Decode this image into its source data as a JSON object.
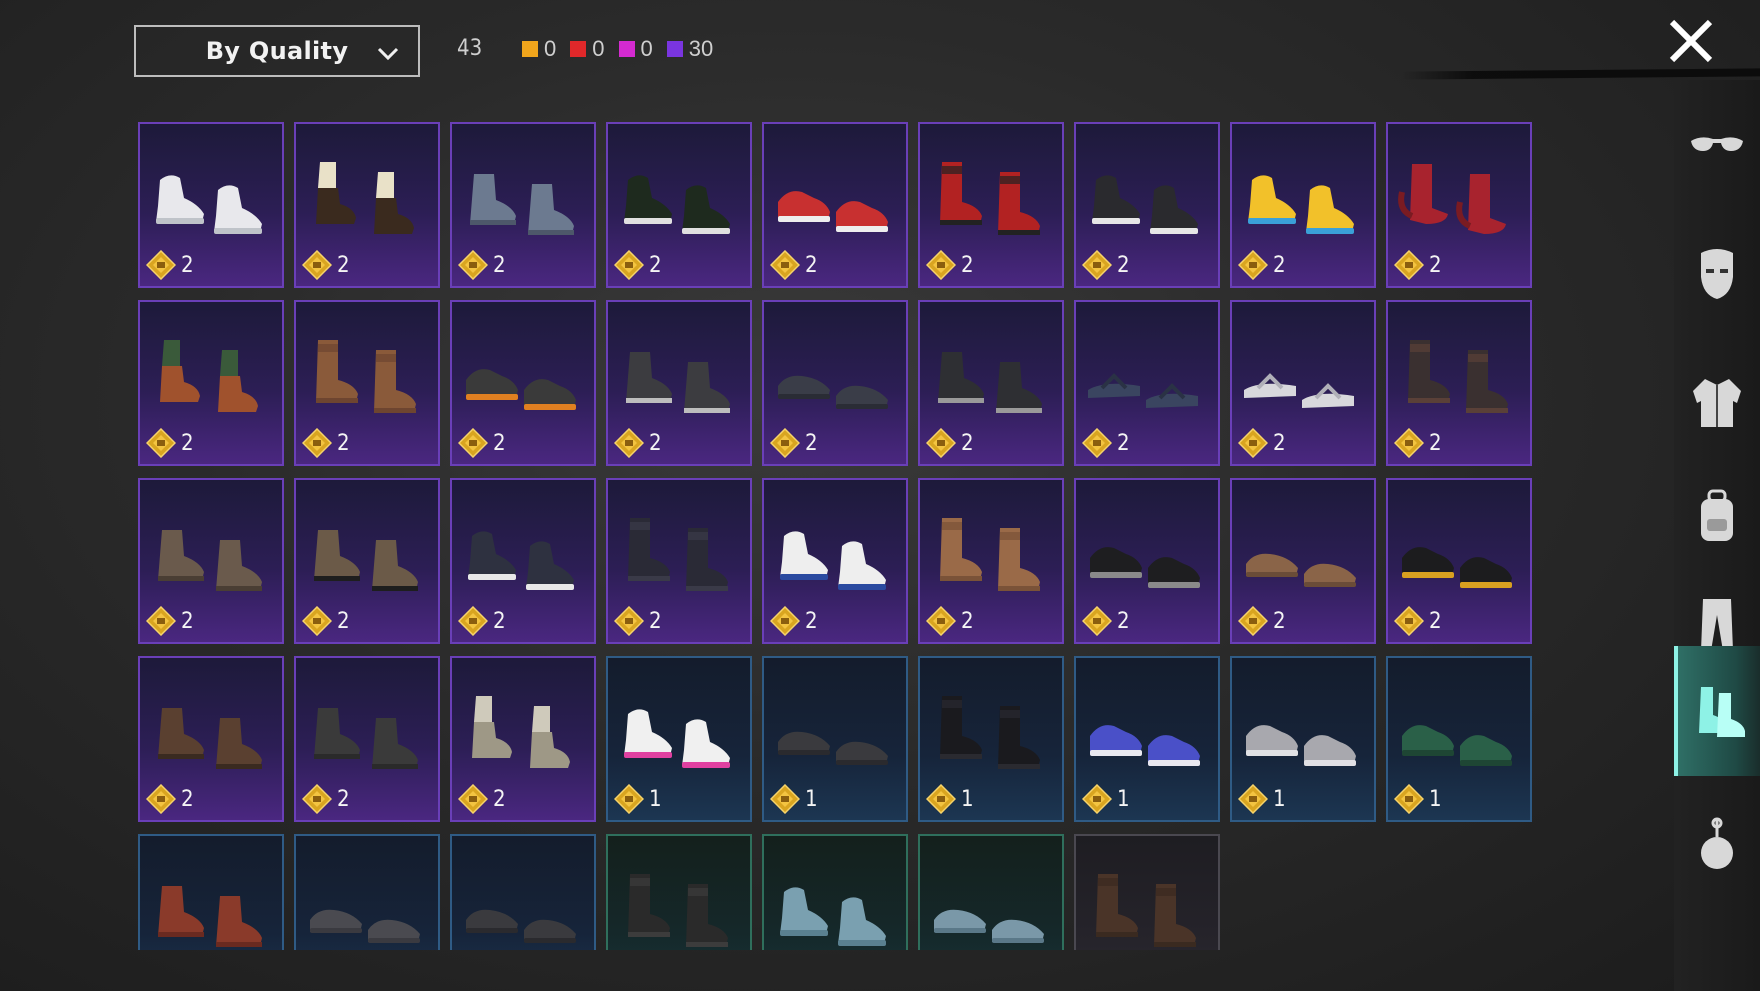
{
  "toolbar": {
    "sort_label": "By Quality",
    "total_count": "43",
    "quality_counts": [
      {
        "color": "#f0a51c",
        "count": "0"
      },
      {
        "color": "#e0282a",
        "count": "0"
      },
      {
        "color": "#d42ad0",
        "count": "0"
      },
      {
        "color": "#7a35e0",
        "count": "30"
      }
    ]
  },
  "items": [
    {
      "tier": "purple",
      "price": "2",
      "shoe": "sneaker-white",
      "c1": "#e8e8ec",
      "c2": "#bfc3c9"
    },
    {
      "tier": "purple",
      "price": "2",
      "shoe": "boot-sock",
      "c1": "#e9e1c8",
      "c2": "#3a2a1e"
    },
    {
      "tier": "purple",
      "price": "2",
      "shoe": "boot-short",
      "c1": "#6c7a90",
      "c2": "#4d586a"
    },
    {
      "tier": "purple",
      "price": "2",
      "shoe": "sneaker-high",
      "c1": "#1e2a1e",
      "c2": "#e0e0e0"
    },
    {
      "tier": "purple",
      "price": "2",
      "shoe": "sneaker-low",
      "c1": "#c83030",
      "c2": "#eeeeee"
    },
    {
      "tier": "purple",
      "price": "2",
      "shoe": "boot-tall",
      "c1": "#b22222",
      "c2": "#222222"
    },
    {
      "tier": "purple",
      "price": "2",
      "shoe": "sneaker-high",
      "c1": "#2a2a2e",
      "c2": "#e6e6e6"
    },
    {
      "tier": "purple",
      "price": "2",
      "shoe": "sneaker-high",
      "c1": "#f2c12a",
      "c2": "#3aa0d8"
    },
    {
      "tier": "purple",
      "price": "2",
      "shoe": "boot-curl",
      "c1": "#a8232e",
      "c2": "#7a1b22"
    },
    {
      "tier": "purple",
      "price": "2",
      "shoe": "boot-sock",
      "c1": "#3a5a3a",
      "c2": "#a0522d"
    },
    {
      "tier": "purple",
      "price": "2",
      "shoe": "boot-tall",
      "c1": "#8a5a3a",
      "c2": "#6e4530"
    },
    {
      "tier": "purple",
      "price": "2",
      "shoe": "sneaker-low",
      "c1": "#3a3a3a",
      "c2": "#e08020"
    },
    {
      "tier": "purple",
      "price": "2",
      "shoe": "boot-short",
      "c1": "#3c3c40",
      "c2": "#bdbdbd"
    },
    {
      "tier": "purple",
      "price": "2",
      "shoe": "loafer",
      "c1": "#3a3d48",
      "c2": "#2a2c35"
    },
    {
      "tier": "purple",
      "price": "2",
      "shoe": "boot-short",
      "c1": "#2e2f33",
      "c2": "#9a9a9a"
    },
    {
      "tier": "purple",
      "price": "2",
      "shoe": "sandal",
      "c1": "#3a4560",
      "c2": "#2a3245"
    },
    {
      "tier": "purple",
      "price": "2",
      "shoe": "sandal",
      "c1": "#d8d8dc",
      "c2": "#b0b0b8"
    },
    {
      "tier": "purple",
      "price": "2",
      "shoe": "boot-tall",
      "c1": "#3a3030",
      "c2": "#5a4038"
    },
    {
      "tier": "purple",
      "price": "2",
      "shoe": "boot-short",
      "c1": "#6a5a4c",
      "c2": "#4a3e34"
    },
    {
      "tier": "purple",
      "price": "2",
      "shoe": "boot-short",
      "c1": "#6b5a48",
      "c2": "#1e1e1e"
    },
    {
      "tier": "purple",
      "price": "2",
      "shoe": "sneaker-high",
      "c1": "#2e3140",
      "c2": "#e8e8e8"
    },
    {
      "tier": "purple",
      "price": "2",
      "shoe": "boot-tall",
      "c1": "#2a2a36",
      "c2": "#3a3a48"
    },
    {
      "tier": "purple",
      "price": "2",
      "shoe": "sneaker-high",
      "c1": "#eeeeee",
      "c2": "#2a4aa0"
    },
    {
      "tier": "purple",
      "price": "2",
      "shoe": "boot-tall",
      "c1": "#9a6a48",
      "c2": "#7a5238"
    },
    {
      "tier": "purple",
      "price": "2",
      "shoe": "sneaker-low",
      "c1": "#1e1e20",
      "c2": "#8a8a8a"
    },
    {
      "tier": "purple",
      "price": "2",
      "shoe": "loafer",
      "c1": "#8a6448",
      "c2": "#6a4c38"
    },
    {
      "tier": "purple",
      "price": "2",
      "shoe": "sneaker-low",
      "c1": "#1c1c1e",
      "c2": "#d8a020"
    },
    {
      "tier": "purple",
      "price": "2",
      "shoe": "boot-short",
      "c1": "#5a4030",
      "c2": "#3a2a20"
    },
    {
      "tier": "purple",
      "price": "2",
      "shoe": "boot-short",
      "c1": "#3a3a3a",
      "c2": "#2a2a2a"
    },
    {
      "tier": "purple",
      "price": "2",
      "shoe": "boot-sock",
      "c1": "#cfcabb",
      "c2": "#9e9886"
    },
    {
      "tier": "blue",
      "price": "1",
      "shoe": "sneaker-high",
      "c1": "#f0f0f0",
      "c2": "#e040a0"
    },
    {
      "tier": "blue",
      "price": "1",
      "shoe": "loafer",
      "c1": "#3a3a3e",
      "c2": "#2a2a2e"
    },
    {
      "tier": "blue",
      "price": "1",
      "shoe": "boot-tall",
      "c1": "#1a1a1e",
      "c2": "#2a2a30"
    },
    {
      "tier": "blue",
      "price": "1",
      "shoe": "sneaker-low",
      "c1": "#4a50c8",
      "c2": "#e8e8f0"
    },
    {
      "tier": "blue",
      "price": "1",
      "shoe": "sneaker-low",
      "c1": "#a8a8ae",
      "c2": "#e0e0e4"
    },
    {
      "tier": "blue",
      "price": "1",
      "shoe": "sneaker-low",
      "c1": "#2a6048",
      "c2": "#1e4634"
    },
    {
      "tier": "blue",
      "price": "",
      "shoe": "boot-short",
      "c1": "#8a3a2a",
      "c2": "#6a2a20"
    },
    {
      "tier": "blue",
      "price": "",
      "shoe": "loafer",
      "c1": "#4a4a50",
      "c2": "#3a3a40"
    },
    {
      "tier": "blue",
      "price": "",
      "shoe": "loafer",
      "c1": "#3a3a3e",
      "c2": "#2a2a2e"
    },
    {
      "tier": "green",
      "price": "",
      "shoe": "boot-tall",
      "c1": "#2a2a2a",
      "c2": "#3c3c3c"
    },
    {
      "tier": "green",
      "price": "",
      "shoe": "sneaker-high",
      "c1": "#7aa0b0",
      "c2": "#5a8090"
    },
    {
      "tier": "green",
      "price": "",
      "shoe": "loafer",
      "c1": "#7a98a8",
      "c2": "#5a7888"
    },
    {
      "tier": "gray",
      "price": "",
      "shoe": "boot-tall",
      "c1": "#4a3428",
      "c2": "#3a2a20"
    }
  ],
  "sidebar": [
    {
      "name": "glasses-icon"
    },
    {
      "name": "mask-icon"
    },
    {
      "name": "jacket-icon"
    },
    {
      "name": "backpack-icon"
    },
    {
      "name": "pants-icon"
    },
    {
      "name": "shoes-icon",
      "active": true
    },
    {
      "name": "accessory-icon"
    }
  ]
}
